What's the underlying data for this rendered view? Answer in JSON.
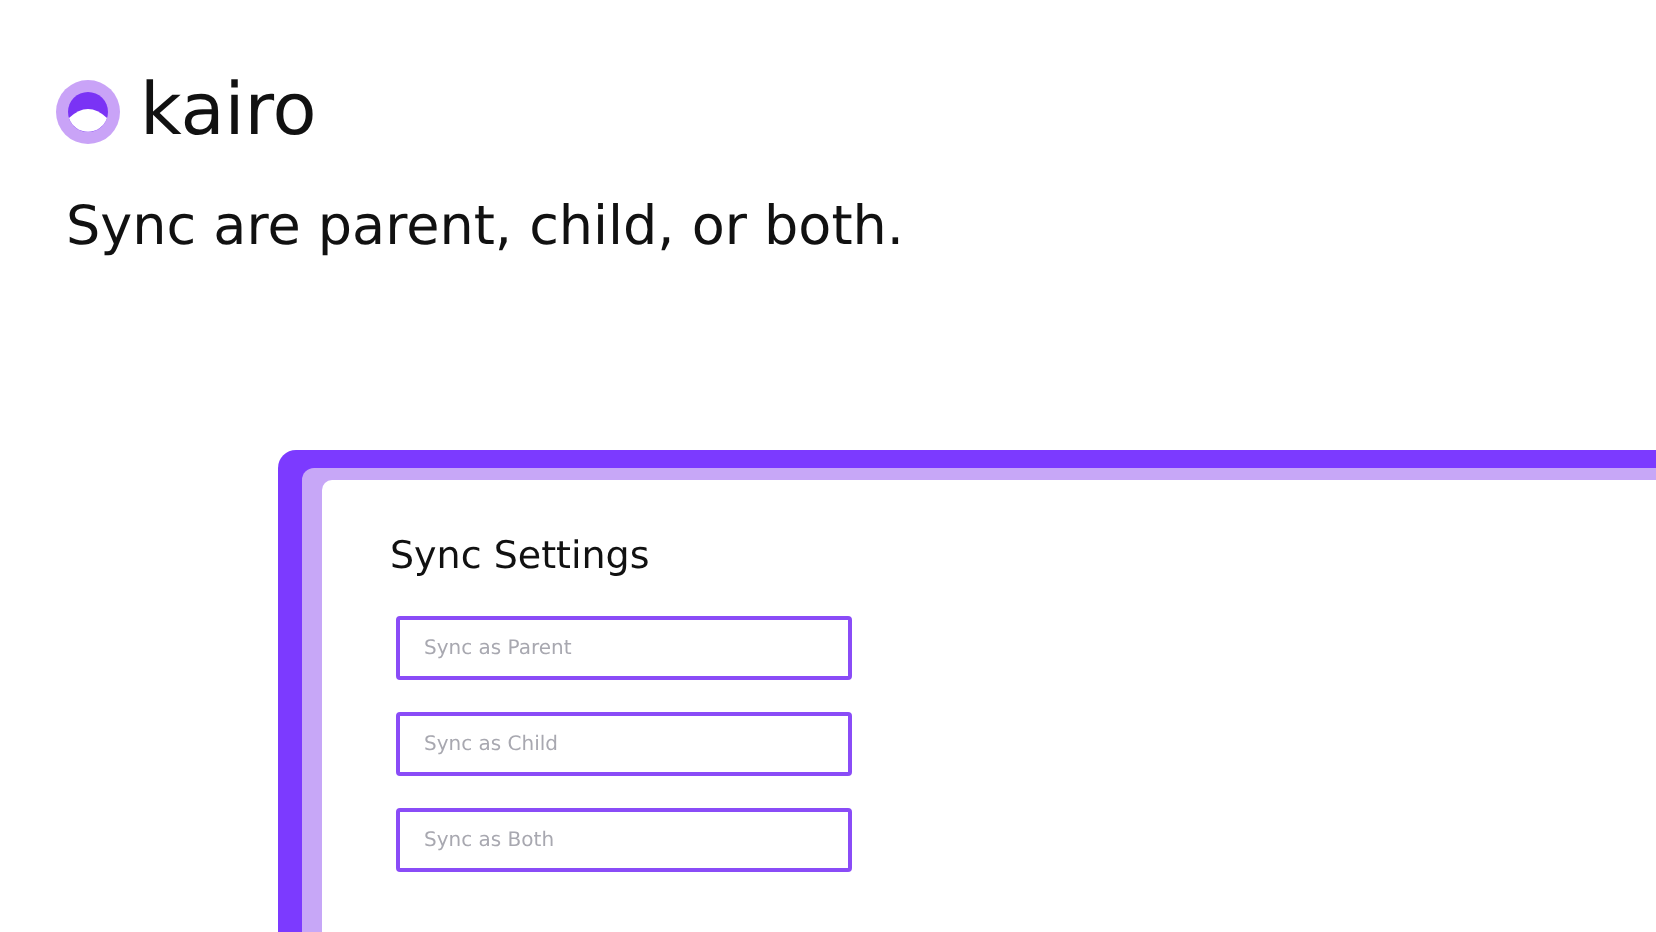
{
  "brand": {
    "name": "kairo"
  },
  "headline": "Sync are parent, child, or both.",
  "panel": {
    "title": "Sync Settings",
    "fields": [
      {
        "placeholder": "Sync as Parent"
      },
      {
        "placeholder": "Sync as Child"
      },
      {
        "placeholder": "Sync as Both"
      }
    ]
  }
}
